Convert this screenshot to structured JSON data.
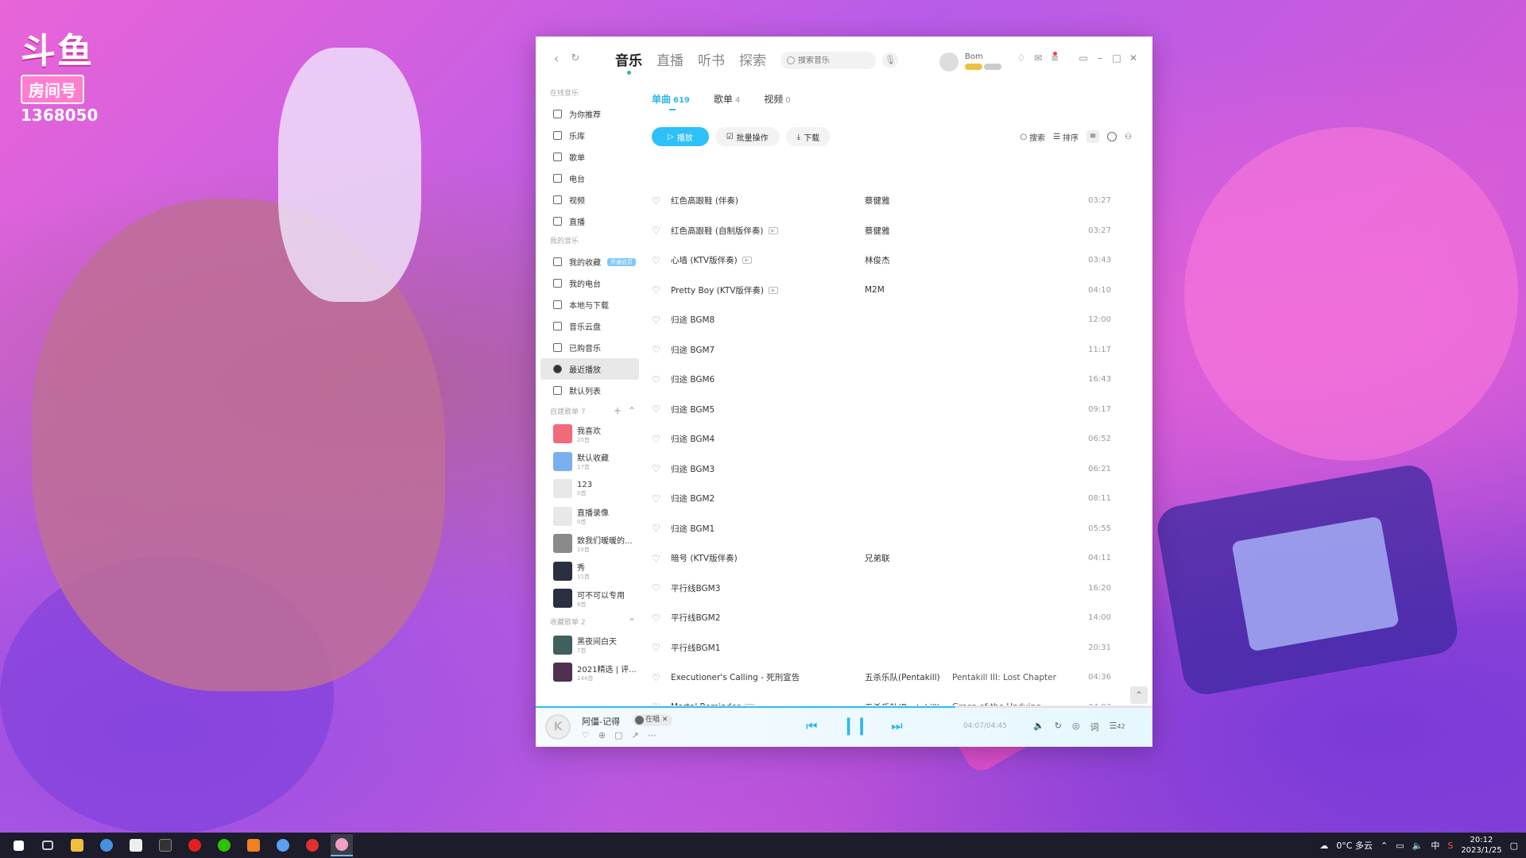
{
  "overlay": {
    "logo_mark": "斗鱼",
    "room_label": "房间号",
    "room_number": "1368050"
  },
  "topbar": {
    "tabs": [
      {
        "label": "音乐",
        "active": true
      },
      {
        "label": "直播"
      },
      {
        "label": "听书"
      },
      {
        "label": "探索"
      }
    ],
    "search_placeholder": "搜索音乐",
    "username": "Bom"
  },
  "sidebar": {
    "online_title": "在线音乐",
    "online_items": [
      "为你推荐",
      "乐库",
      "歌单",
      "电台",
      "视频",
      "直播"
    ],
    "my_title": "我的音乐",
    "my_items": [
      "我的收藏",
      "我的电台",
      "本地与下载",
      "音乐云盘",
      "已购音乐",
      "最近播放",
      "默认列表"
    ],
    "my_badge": "开通会员",
    "created_title": "自建歌单 7",
    "created_playlists": [
      {
        "name": "我喜欢",
        "count": "20首",
        "color": "#f06a7a"
      },
      {
        "name": "默认收藏",
        "count": "17首",
        "color": "#7ab0f0"
      },
      {
        "name": "123",
        "count": "0首",
        "color": "#e8e8e8"
      },
      {
        "name": "直播录像",
        "count": "0首",
        "color": "#e8e8e8"
      },
      {
        "name": "致我们暖暖的...",
        "count": "10首",
        "color": "#8a8a8a"
      },
      {
        "name": "秀",
        "count": "11首",
        "color": "#2a3040"
      },
      {
        "name": "可不可以专用",
        "count": "8首",
        "color": "#2a3040"
      }
    ],
    "collected_title": "收藏歌单 2",
    "collected_playlists": [
      {
        "name": "黑夜间白天",
        "count": "7首",
        "color": "#406060"
      },
      {
        "name": "2021精选 | 评...",
        "count": "144首",
        "color": "#503050"
      }
    ]
  },
  "main": {
    "tabs": [
      {
        "label": "单曲",
        "count": "619",
        "active": true
      },
      {
        "label": "歌单",
        "count": "4"
      },
      {
        "label": "视频",
        "count": "0"
      }
    ],
    "play_label": "播放",
    "batch_label": "批量操作",
    "download_label": "下载",
    "search_label": "搜索",
    "sort_label": "排序",
    "songs": [
      {
        "title": "红色高跟鞋 (伴奏)",
        "mv": false,
        "artist": "蔡健雅",
        "album": "",
        "duration": "03:27"
      },
      {
        "title": "红色高跟鞋 (自制版伴奏)",
        "mv": true,
        "artist": "蔡健雅",
        "album": "",
        "duration": "03:27"
      },
      {
        "title": "心墙 (KTV版伴奏)",
        "mv": true,
        "artist": "林俊杰",
        "album": "",
        "duration": "03:43"
      },
      {
        "title": "Pretty Boy (KTV版伴奏)",
        "mv": true,
        "artist": "M2M",
        "album": "",
        "duration": "04:10"
      },
      {
        "title": "归途 BGM8",
        "mv": false,
        "artist": "",
        "album": "",
        "duration": "12:00"
      },
      {
        "title": "归途 BGM7",
        "mv": false,
        "artist": "",
        "album": "",
        "duration": "11:17"
      },
      {
        "title": "归途 BGM6",
        "mv": false,
        "artist": "",
        "album": "",
        "duration": "16:43"
      },
      {
        "title": "归途 BGM5",
        "mv": false,
        "artist": "",
        "album": "",
        "duration": "09:17"
      },
      {
        "title": "归途 BGM4",
        "mv": false,
        "artist": "",
        "album": "",
        "duration": "06:52"
      },
      {
        "title": "归途 BGM3",
        "mv": false,
        "artist": "",
        "album": "",
        "duration": "06:21"
      },
      {
        "title": "归途  BGM2",
        "mv": false,
        "artist": "",
        "album": "",
        "duration": "08:11"
      },
      {
        "title": "归途 BGM1",
        "mv": false,
        "artist": "",
        "album": "",
        "duration": "05:55"
      },
      {
        "title": "暗号 (KTV版伴奏)",
        "mv": false,
        "artist": "兄弟联",
        "album": "",
        "duration": "04:11"
      },
      {
        "title": "平行线BGM3",
        "mv": false,
        "artist": "",
        "album": "",
        "duration": "16:20"
      },
      {
        "title": "平行线BGM2",
        "mv": false,
        "artist": "",
        "album": "",
        "duration": "14:00"
      },
      {
        "title": "平行线BGM1",
        "mv": false,
        "artist": "",
        "album": "",
        "duration": "20:31"
      },
      {
        "title": "Executioner's Calling - 死刑宣告",
        "mv": false,
        "artist": "五杀乐队(Pentakill)",
        "album": "Pentakill III: Lost Chapter",
        "duration": "04:36"
      },
      {
        "title": "Mortal Reminder",
        "mv": true,
        "artist": "五杀乐队(Pentakill)",
        "album": "Grasp of the Undying",
        "duration": "04:03"
      }
    ]
  },
  "player": {
    "now_playing": "阿僵-记得",
    "live_tag": "在唱",
    "time": "04:07/04:45",
    "progress": 0.68,
    "playlist_count": "42"
  },
  "taskbar": {
    "weather": "0°C 多云",
    "ime": "中",
    "time": "20:12",
    "date": "2023/1/25"
  },
  "colors": {
    "accent": "#2ec0f8",
    "active_tab_dot": "#31c27c"
  }
}
